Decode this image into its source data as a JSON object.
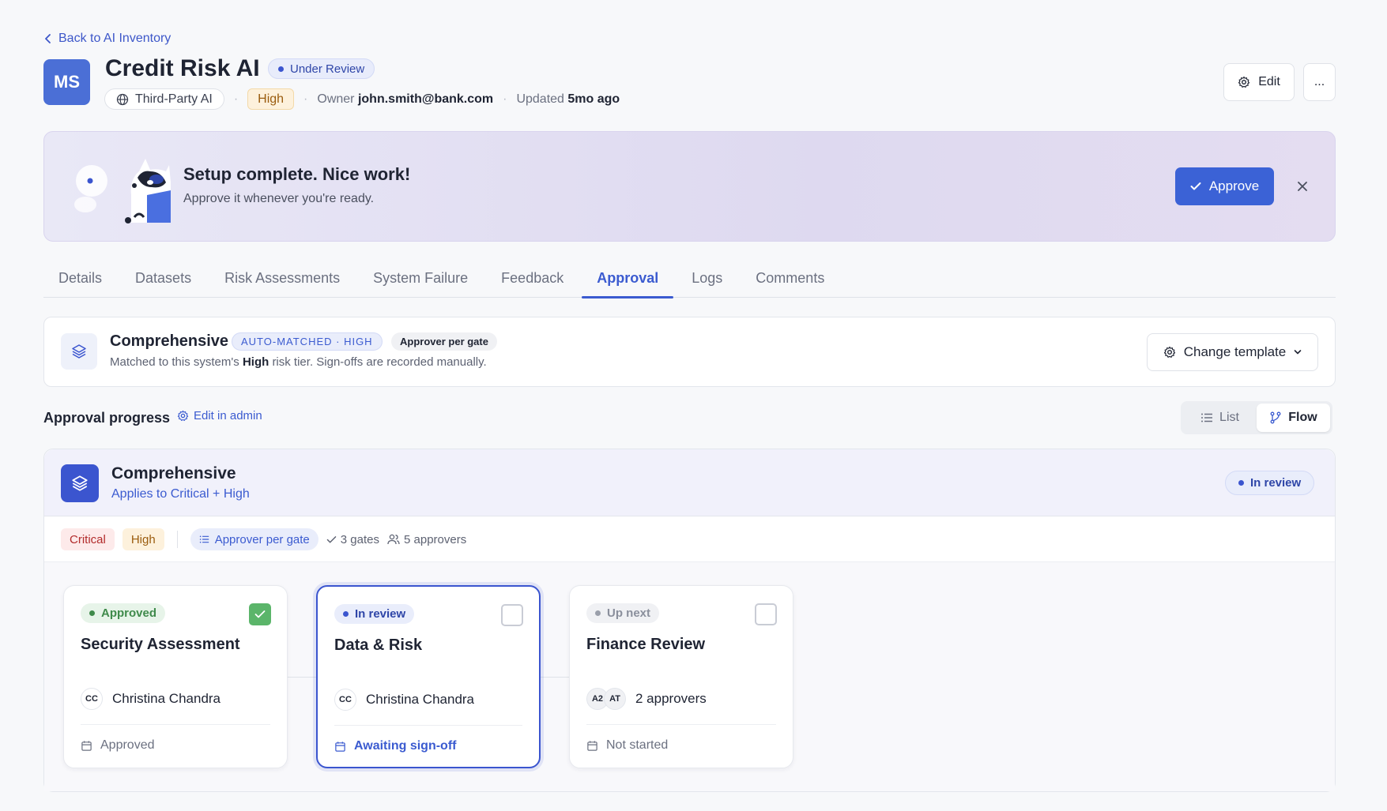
{
  "header": {
    "back_label": "Back to AI Inventory",
    "avatar_initials": "MS",
    "title": "Credit Risk AI",
    "status": "Under Review",
    "type_chip": "Third-Party AI",
    "risk_chip": "High",
    "owner_label": "Owner",
    "owner_value": "john.smith@bank.com",
    "updated_label": "Updated",
    "updated_value": "5mo ago",
    "edit_label": "Edit",
    "more_label": "..."
  },
  "banner": {
    "title": "Setup complete. Nice work!",
    "subtitle": "Approve it whenever you're ready.",
    "approve_label": "Approve"
  },
  "tabs": [
    {
      "label": "Details"
    },
    {
      "label": "Datasets"
    },
    {
      "label": "Risk Assessments"
    },
    {
      "label": "System Failure"
    },
    {
      "label": "Feedback"
    },
    {
      "label": "Approval",
      "active": true
    },
    {
      "label": "Logs"
    },
    {
      "label": "Comments"
    }
  ],
  "template": {
    "name": "Comprehensive",
    "badge_match": "AUTO-MATCHED · HIGH",
    "badge_mode": "Approver per gate",
    "desc_prefix": "Matched to this system's",
    "desc_strong": "High",
    "desc_suffix": "risk tier. Sign-offs are recorded manually.",
    "change_label": "Change template"
  },
  "progress": {
    "title": "Approval progress",
    "edit_admin": "Edit in admin",
    "view_list": "List",
    "view_flow": "Flow",
    "active_view": "Flow"
  },
  "flow": {
    "name": "Comprehensive",
    "applies": "Applies to Critical + High",
    "status": "In review",
    "tiers": [
      "Critical",
      "High"
    ],
    "mode": "Approver per gate",
    "gates_count": "3 gates",
    "approvers_count": "5 approvers",
    "gates": [
      {
        "status": "Approved",
        "title": "Security Assessment",
        "approver_initials": "CC",
        "approver": "Christina Chandra",
        "footer": "Approved",
        "checked": true
      },
      {
        "status": "In review",
        "title": "Data & Risk",
        "approver_initials": "CC",
        "approver": "Christina Chandra",
        "footer": "Awaiting sign-off",
        "checked": false
      },
      {
        "status": "Up next",
        "title": "Finance Review",
        "approver_initials_1": "A2",
        "approver_initials_2": "AT",
        "approver": "2 approvers",
        "footer": "Not started",
        "checked": false
      }
    ]
  },
  "colors": {
    "accent": "#3b5bd0",
    "approved": "#5bb56a",
    "critical": "#b22b2b",
    "high": "#9a5c0e"
  },
  "icons": [
    "chevron-left-icon",
    "globe-icon",
    "gear-icon",
    "check-icon",
    "close-icon",
    "layers-icon",
    "list-icon",
    "flow-icon",
    "users-icon",
    "calendar-icon",
    "chevron-down-icon"
  ]
}
